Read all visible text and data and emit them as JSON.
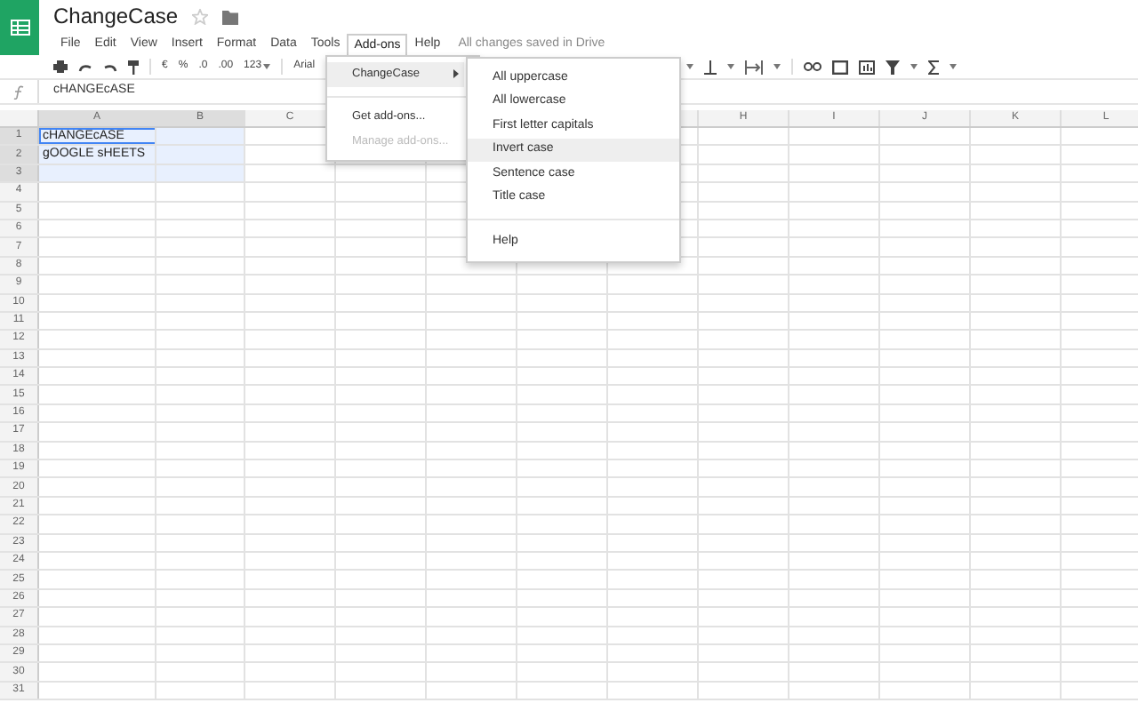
{
  "document": {
    "title": "ChangeCase"
  },
  "menu_bar": [
    {
      "label": "File",
      "selected": false
    },
    {
      "label": "Edit",
      "selected": false
    },
    {
      "label": "View",
      "selected": false
    },
    {
      "label": "Insert",
      "selected": false
    },
    {
      "label": "Format",
      "selected": false
    },
    {
      "label": "Data",
      "selected": false
    },
    {
      "label": "Tools",
      "selected": false
    },
    {
      "label": "Add-ons",
      "selected": true
    },
    {
      "label": "Help",
      "selected": false
    }
  ],
  "save_status": "All changes saved in Drive",
  "toolbar": {
    "currency": "€",
    "percent": "%",
    "decrease_decimals": ".0",
    "increase_decimals": ".00",
    "more_formats": "123",
    "font": "Arial"
  },
  "formula_bar": {
    "value": "cHANGEcASE"
  },
  "columns": [
    {
      "label": "A",
      "selected": true
    },
    {
      "label": "B",
      "selected": true
    },
    {
      "label": "C",
      "selected": false
    },
    {},
    {},
    {},
    {},
    {
      "label": "H",
      "selected": false
    },
    {
      "label": "I",
      "selected": false
    },
    {
      "label": "J",
      "selected": false
    },
    {
      "label": "K",
      "selected": false
    },
    {
      "label": "L",
      "selected": false
    }
  ],
  "rows": [
    {
      "number": "1",
      "selected": true,
      "cells": [
        {
          "text": "cHANGEcASE",
          "active": true
        }
      ]
    },
    {
      "number": "2",
      "selected": true,
      "cells": [
        {
          "text": "gOOGLE sHEETS",
          "active": false
        }
      ]
    },
    {
      "number": "3",
      "selected": true
    },
    {
      "number": "4",
      "selected": false
    },
    {
      "number": "5",
      "selected": false
    },
    {
      "number": "6",
      "selected": false
    },
    {
      "number": "7",
      "selected": false
    },
    {
      "number": "8",
      "selected": false
    },
    {
      "number": "9",
      "selected": false
    },
    {
      "number": "10",
      "selected": false
    },
    {
      "number": "11",
      "selected": false
    },
    {
      "number": "12",
      "selected": false
    },
    {
      "number": "13",
      "selected": false
    },
    {
      "number": "14",
      "selected": false
    },
    {
      "number": "15",
      "selected": false
    },
    {
      "number": "16",
      "selected": false
    },
    {
      "number": "17",
      "selected": false
    },
    {
      "number": "18",
      "selected": false
    },
    {
      "number": "19",
      "selected": false
    },
    {
      "number": "20",
      "selected": false
    },
    {
      "number": "21",
      "selected": false
    },
    {
      "number": "22",
      "selected": false
    },
    {
      "number": "23",
      "selected": false
    },
    {
      "number": "24",
      "selected": false
    },
    {
      "number": "25",
      "selected": false
    },
    {
      "number": "26",
      "selected": false
    },
    {
      "number": "27",
      "selected": false
    },
    {
      "number": "28",
      "selected": false
    },
    {
      "number": "29",
      "selected": false
    },
    {
      "number": "30",
      "selected": false
    },
    {
      "number": "31",
      "selected": false
    }
  ],
  "addons_menu": {
    "items": [
      {
        "kind": "submenu",
        "label": "ChangeCase",
        "selected": true,
        "disabled": false
      },
      {
        "kind": "separator"
      },
      {
        "kind": "item",
        "label": "Get add-ons...",
        "selected": false,
        "disabled": false
      },
      {
        "kind": "item",
        "label": "Manage add-ons...",
        "selected": false,
        "disabled": true
      }
    ]
  },
  "changecase_submenu": {
    "items": [
      {
        "kind": "item",
        "label": "All uppercase",
        "selected": false
      },
      {
        "kind": "item",
        "label": "All lowercase",
        "selected": false
      },
      {
        "kind": "item",
        "label": "First letter capitals",
        "selected": false
      },
      {
        "kind": "item",
        "label": "Invert case",
        "selected": true
      },
      {
        "kind": "item",
        "label": "Sentence case",
        "selected": false
      },
      {
        "kind": "item",
        "label": "Title case",
        "selected": false
      },
      {
        "kind": "separator"
      },
      {
        "kind": "item",
        "label": "Help",
        "selected": false
      }
    ]
  }
}
